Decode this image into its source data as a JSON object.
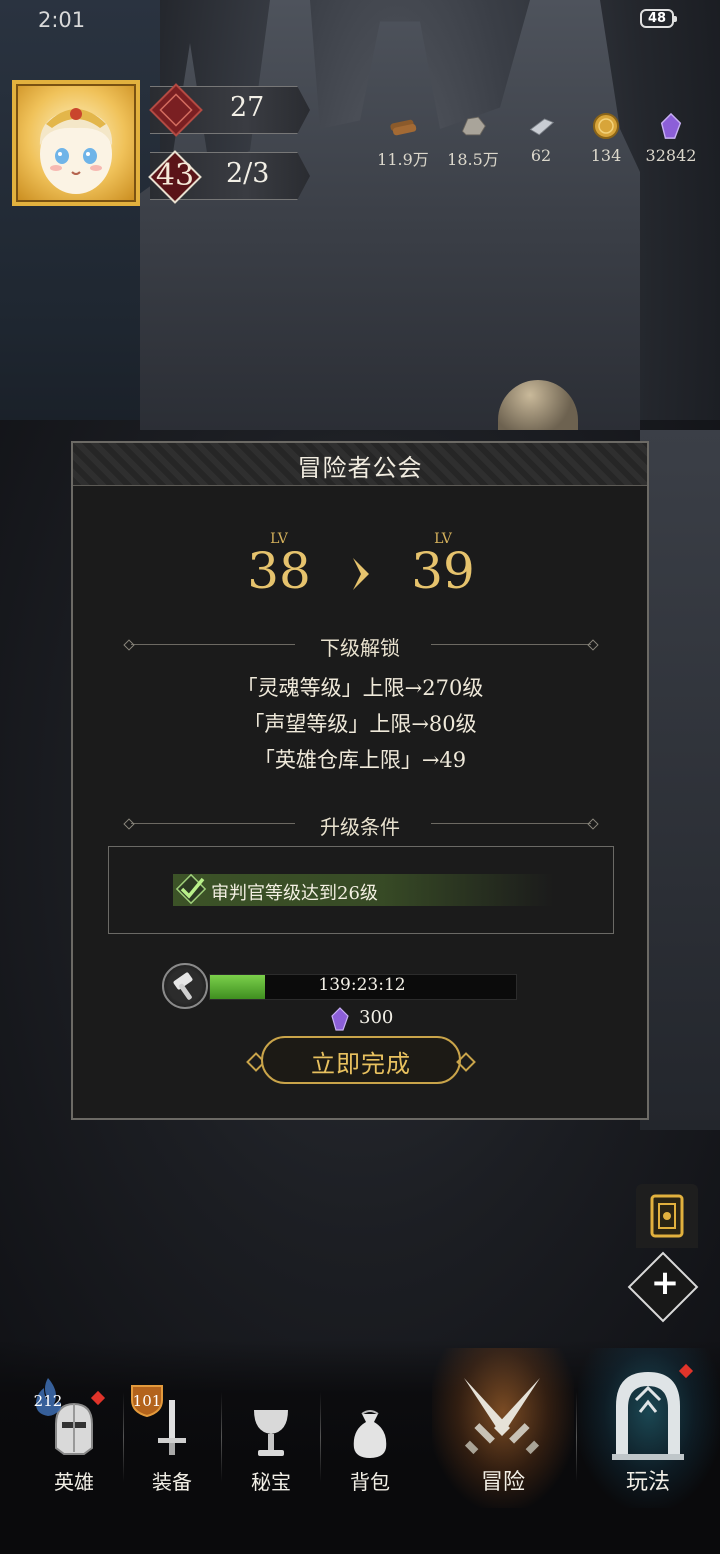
{
  "status_bar": {
    "time": "2:01",
    "battery": "48"
  },
  "player": {
    "level": "27",
    "stamina_icon_value": "43",
    "stamina": "2/3"
  },
  "resources": [
    {
      "icon": "wood-icon",
      "value": "11.9万"
    },
    {
      "icon": "stone-icon",
      "value": "18.5万"
    },
    {
      "icon": "iron-icon",
      "value": "62"
    },
    {
      "icon": "gold-coin-icon",
      "value": "134"
    },
    {
      "icon": "purple-crystal-icon",
      "value": "32842"
    }
  ],
  "dialog": {
    "title": "冒险者公会",
    "current_level_tag": "LV",
    "current_level": "38",
    "next_level_tag": "LV",
    "next_level": "39",
    "unlock_title": "下级解锁",
    "unlocks": [
      "「灵魂等级」上限→270级",
      "「声望等级」上限→80级",
      "「英雄仓库上限」→49"
    ],
    "condition_title": "升级条件",
    "condition_text": "审判官等级达到26级",
    "timer": "139:23:12",
    "timer_progress": 0.18,
    "cost": "300",
    "finish_button": "立即完成"
  },
  "bottom_nav": [
    {
      "label": "英雄",
      "icon": "knight-helmet-icon",
      "badge": "212",
      "red_dot": true
    },
    {
      "label": "装备",
      "icon": "sword-icon",
      "badge": "101",
      "red_dot": false
    },
    {
      "label": "秘宝",
      "icon": "chalice-icon",
      "badge": "",
      "red_dot": false
    },
    {
      "label": "背包",
      "icon": "bag-icon",
      "badge": "",
      "red_dot": false
    },
    {
      "label": "冒险",
      "icon": "crossed-swords-icon",
      "badge": "",
      "red_dot": false
    },
    {
      "label": "玩法",
      "icon": "gate-icon",
      "badge": "",
      "red_dot": true
    }
  ],
  "colors": {
    "gold_text": "#e6c36d",
    "progress_green": "#7bd04b",
    "alert_red": "#e0342a"
  }
}
